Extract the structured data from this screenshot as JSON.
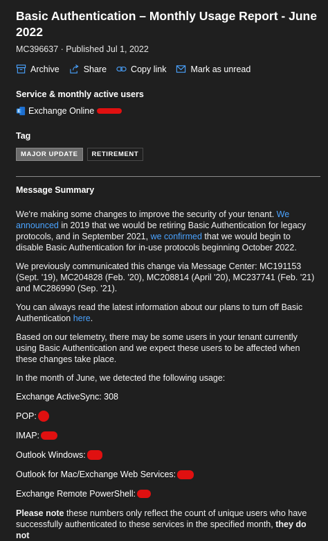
{
  "message": {
    "title": "Basic Authentication – Monthly Usage Report - June 2022",
    "meta": "MC396637 · Published Jul 1, 2022"
  },
  "actions": {
    "archive": "Archive",
    "share": "Share",
    "copy_link": "Copy link",
    "mark_unread": "Mark as unread"
  },
  "service": {
    "label": "Service & monthly active users",
    "name": "Exchange Online"
  },
  "tag": {
    "label": "Tag",
    "items": [
      "MAJOR UPDATE",
      "RETIREMENT"
    ]
  },
  "summary": {
    "heading": "Message Summary",
    "p1_a": "We're making some changes to improve the security of your tenant. ",
    "p1_link1": "We announced",
    "p1_b": " in 2019 that we would be retiring Basic Authentication for legacy protocols, and in September 2021, ",
    "p1_link2": "we confirmed",
    "p1_c": " that we would begin to disable Basic Authentication for in-use protocols beginning October 2022.",
    "p2": "We previously communicated this change via Message Center: MC191153 (Sept. '19), MC204828 (Feb. '20), MC208814 (April '20), MC237741 (Feb. '21) and MC286990 (Sep. '21).",
    "p3_a": "You can always read the latest information about our plans to turn off Basic Authentication ",
    "p3_link": "here",
    "p3_b": ".",
    "p4": "Based on our telemetry, there may be some users in your tenant currently using Basic Authentication and we expect these users to be affected when these changes take place.",
    "p5": "In the month of June, we detected the following usage:",
    "usage": {
      "eas": "Exchange ActiveSync: 308",
      "pop": "POP:",
      "imap": "IMAP:",
      "outlook_win": "Outlook Windows:",
      "outlook_mac": "Outlook for Mac/Exchange Web Services:",
      "powershell": "Exchange Remote PowerShell:"
    },
    "note_bold": "Please note",
    "note_text": " these numbers only reflect the count of unique users who have successfully authenticated to these services in the specified month, ",
    "note_bold2": "they do not"
  },
  "colors": {
    "background": "#1f1f1f",
    "link": "#4aa3ff",
    "redaction": "#e01010"
  }
}
